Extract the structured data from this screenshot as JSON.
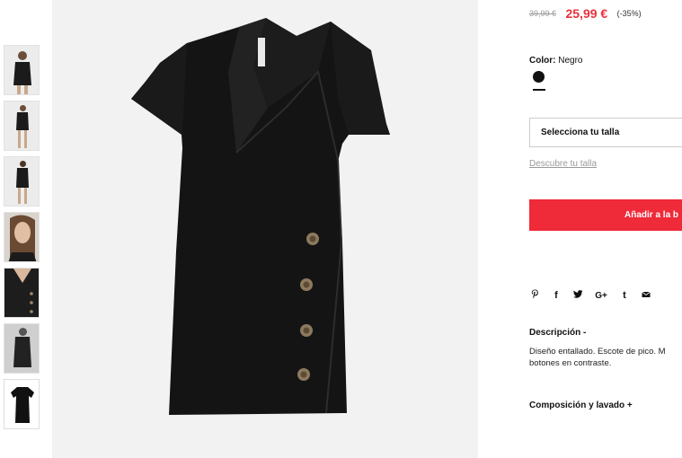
{
  "gallery": {
    "thumbnails": [
      {
        "alt": "model-front"
      },
      {
        "alt": "model-full"
      },
      {
        "alt": "model-back"
      },
      {
        "alt": "model-face"
      },
      {
        "alt": "detail-buttons"
      },
      {
        "alt": "model-bw"
      },
      {
        "alt": "product-flat"
      }
    ],
    "main_image": "black wrap dress with buttons"
  },
  "price": {
    "old": "39,99 €",
    "new": "25,99 €",
    "discount": "(-35%)"
  },
  "color": {
    "label": "Color:",
    "value": "Negro",
    "swatch_color": "#111111"
  },
  "size": {
    "select_label": "Selecciona tu talla",
    "guide_link": "Descubre tu talla"
  },
  "cart": {
    "add_label": "Añadir a la b"
  },
  "share": {
    "icons": [
      "pinterest-icon",
      "facebook-icon",
      "twitter-icon",
      "google-plus-icon",
      "tumblr-icon",
      "email-icon"
    ],
    "glyphs": [
      "𝒑",
      "f",
      "🐦",
      "G+",
      "t",
      "✉"
    ]
  },
  "description": {
    "title": "Descripción -",
    "text": "Diseño entallado. Escote de pico. M botones en contraste."
  },
  "composition": {
    "title": "Composición y lavado +"
  },
  "colors": {
    "accent": "#ef2a39",
    "price_red": "#e8313c"
  }
}
